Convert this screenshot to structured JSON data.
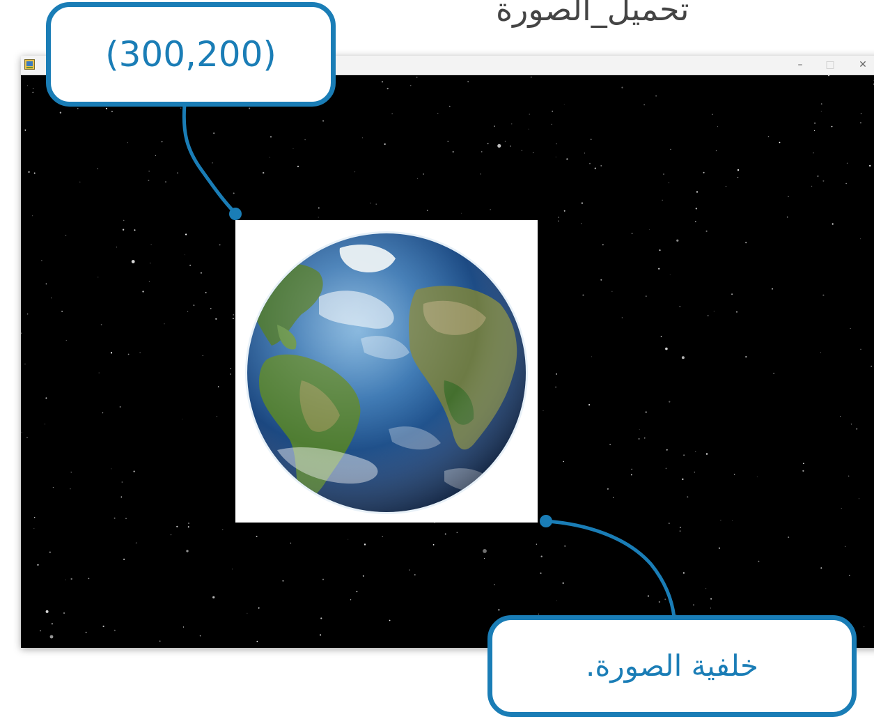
{
  "top_text": "تحميل_الصورة",
  "window": {
    "title_buttons": {
      "minimize": "–",
      "maximize": "□",
      "close": "✕"
    }
  },
  "callouts": {
    "coordinate": "(300,200)",
    "background": "خلفية الصورة."
  },
  "colors": {
    "accent": "#1a7db6",
    "canvas_background": "#000000",
    "image_background": "#ffffff"
  },
  "icons": [
    "app-icon",
    "minimize-icon",
    "maximize-icon",
    "close-icon",
    "earth-image"
  ]
}
